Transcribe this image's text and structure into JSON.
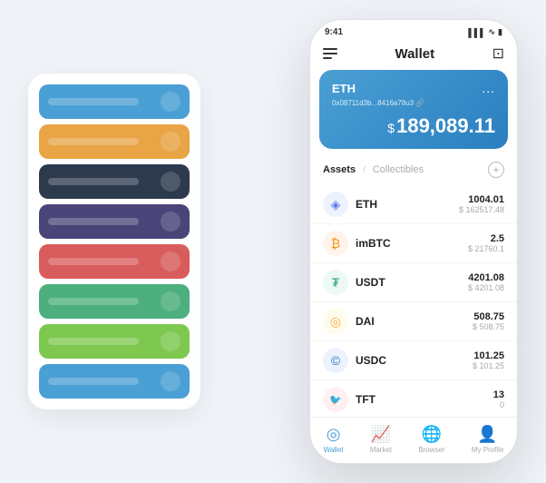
{
  "scene": {
    "cardList": {
      "items": [
        {
          "color": "card-blue",
          "barColor": "rgba(255,255,255,0.5)"
        },
        {
          "color": "card-orange",
          "barColor": "rgba(255,255,255,0.5)"
        },
        {
          "color": "card-dark",
          "barColor": "rgba(255,255,255,0.5)"
        },
        {
          "color": "card-purple",
          "barColor": "rgba(255,255,255,0.5)"
        },
        {
          "color": "card-red",
          "barColor": "rgba(255,255,255,0.5)"
        },
        {
          "color": "card-green",
          "barColor": "rgba(255,255,255,0.5)"
        },
        {
          "color": "card-lightgreen",
          "barColor": "rgba(255,255,255,0.5)"
        },
        {
          "color": "card-blue2",
          "barColor": "rgba(255,255,255,0.5)"
        }
      ]
    },
    "phone": {
      "statusBar": {
        "time": "9:41",
        "signal": "▌▌▌",
        "wifi": "WiFi",
        "battery": "🔋"
      },
      "header": {
        "title": "Wallet"
      },
      "ethCard": {
        "title": "ETH",
        "address": "0x08711d3b...8416a78u3 🔗",
        "dots": "...",
        "balanceSymbol": "$",
        "balance": "189,089.11"
      },
      "assets": {
        "tabActive": "Assets",
        "separator": "/",
        "tabInactive": "Collectibles",
        "addLabel": "+"
      },
      "assetList": [
        {
          "name": "ETH",
          "icon": "◈",
          "iconClass": "eth-color",
          "amount": "1004.01",
          "usd": "$ 162517.48"
        },
        {
          "name": "imBTC",
          "icon": "₿",
          "iconClass": "imbtc-color",
          "amount": "2.5",
          "usd": "$ 21760.1"
        },
        {
          "name": "USDT",
          "icon": "₮",
          "iconClass": "usdt-color",
          "amount": "4201.08",
          "usd": "$ 4201.08"
        },
        {
          "name": "DAI",
          "icon": "◎",
          "iconClass": "dai-color",
          "amount": "508.75",
          "usd": "$ 508.75"
        },
        {
          "name": "USDC",
          "icon": "©",
          "iconClass": "usdc-color",
          "amount": "101.25",
          "usd": "$ 101.25"
        },
        {
          "name": "TFT",
          "icon": "🐦",
          "iconClass": "tft-color",
          "amount": "13",
          "usd": "0"
        }
      ],
      "bottomNav": [
        {
          "label": "Wallet",
          "icon": "◎",
          "active": true
        },
        {
          "label": "Market",
          "icon": "📈",
          "active": false
        },
        {
          "label": "Browser",
          "icon": "🌐",
          "active": false
        },
        {
          "label": "My Profile",
          "icon": "👤",
          "active": false
        }
      ]
    }
  }
}
